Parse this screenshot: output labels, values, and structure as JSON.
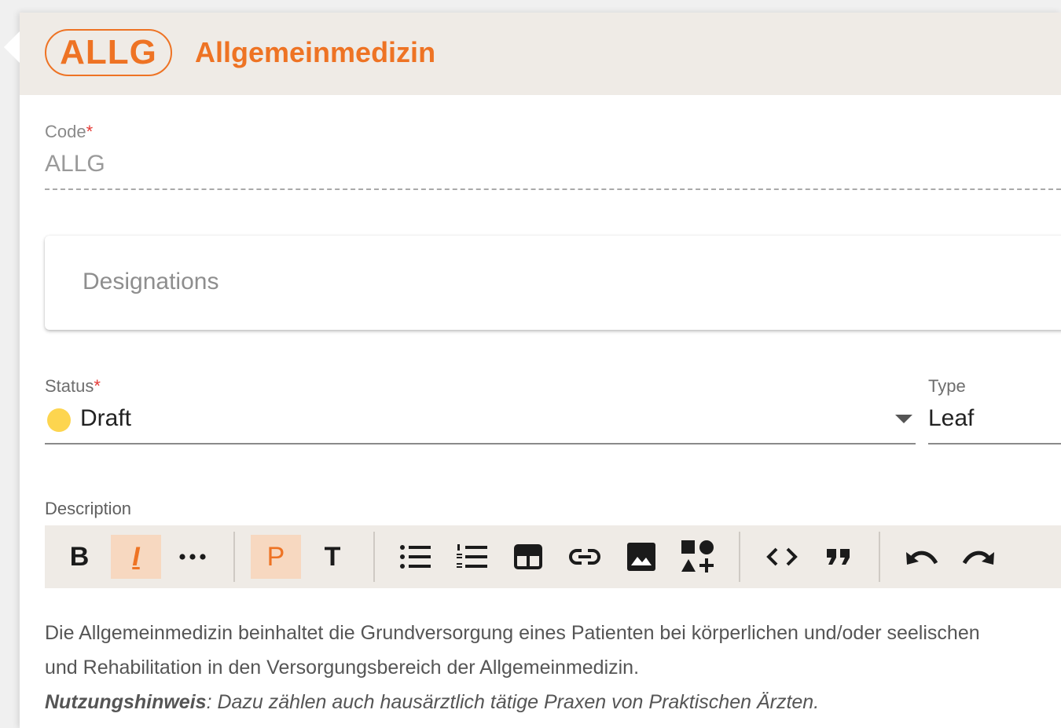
{
  "header": {
    "code_badge": "ALLG",
    "title": "Allgemeinmedizin",
    "accent_color": "#ee7324"
  },
  "code_field": {
    "label": "Code",
    "required_marker": "*",
    "value": "ALLG"
  },
  "designations": {
    "label": "Designations"
  },
  "status_field": {
    "label": "Status",
    "required_marker": "*",
    "value": "Draft",
    "status_color": "#fdd54f"
  },
  "type_field": {
    "label": "Type",
    "value": "Leaf"
  },
  "description": {
    "label": "Description",
    "toolbar": {
      "bold": "B",
      "italic": "I",
      "paragraph": "P",
      "text_style": "T",
      "icons": [
        "bold-icon",
        "italic-icon",
        "more-icon",
        "paragraph-icon",
        "text-icon",
        "bullet-list-icon",
        "numbered-list-icon",
        "table-icon",
        "link-icon",
        "image-icon",
        "shapes-icon",
        "code-icon",
        "quote-icon",
        "undo-icon",
        "redo-icon"
      ]
    },
    "line1": "Die Allgemeinmedizin beinhaltet die Grundversorgung eines Patienten bei körperlichen und/oder seelischen",
    "line2": "und Rehabilitation in den Versorgungsbereich der Allgemeinmedizin.",
    "note_label": "Nutzungshinweis",
    "note_text": ": Dazu zählen auch hausärztlich tätige Praxen von Praktischen Ärzten."
  }
}
